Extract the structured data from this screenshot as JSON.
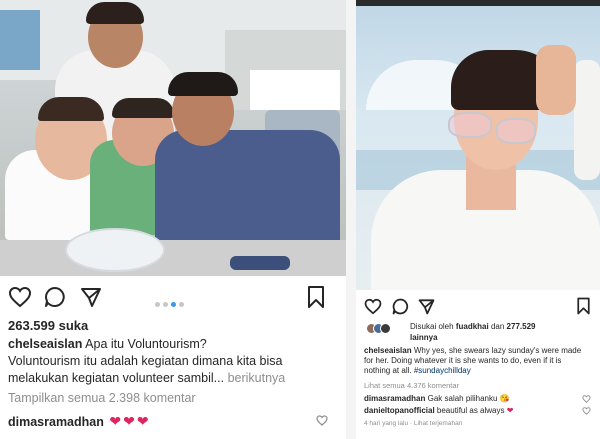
{
  "left_post": {
    "likes": "263.599 suka",
    "caption": {
      "username": "chelseaislan",
      "line1_text": "Apa itu Voluntourism?",
      "line2": "Voluntourism itu adalah kegiatan dimana kita bisa",
      "line3_text": "melakukan kegiatan volunteer sambil...",
      "more": "berikutnya"
    },
    "view_comments": "Tampilkan semua 2.398 komentar",
    "comment": {
      "username": "dimasramadhan",
      "hearts": [
        "❤",
        "❤",
        "❤"
      ]
    },
    "carousel": {
      "count": 4,
      "active_index": 2
    },
    "icons": [
      "heart-icon",
      "comment-icon",
      "share-icon",
      "bookmark-icon"
    ]
  },
  "right_post": {
    "liked_by": {
      "prefix": "Disukai oleh",
      "user": "fuadkhai",
      "and": "dan",
      "count": "277.529",
      "others": "lainnya"
    },
    "caption": {
      "username": "chelseaislan",
      "line1_text": "Why yes, she swears lazy sunday's were made",
      "line2": "for her. Doing whatever it is she wants to do, even if it is",
      "line3_text": "nothing at all.",
      "hashtag": "#sundaychillday"
    },
    "view_comments": "Lihat semua 4.376 komentar",
    "comments": [
      {
        "username": "dimasramadhan",
        "text": "Gak salah pilihanku",
        "emoji": "😘"
      },
      {
        "username": "danieltopanofficial",
        "text": "beautiful as always",
        "emoji": "❤"
      }
    ],
    "time": "4 hari yang lalu",
    "translate": "Lihat terjemahan",
    "icons": [
      "heart-icon",
      "comment-icon",
      "share-icon",
      "bookmark-icon"
    ]
  },
  "colors": {
    "accent_blue": "#3897f0",
    "heart_red": "#e0245e",
    "muted": "#8e8e8e",
    "text": "#262626"
  }
}
